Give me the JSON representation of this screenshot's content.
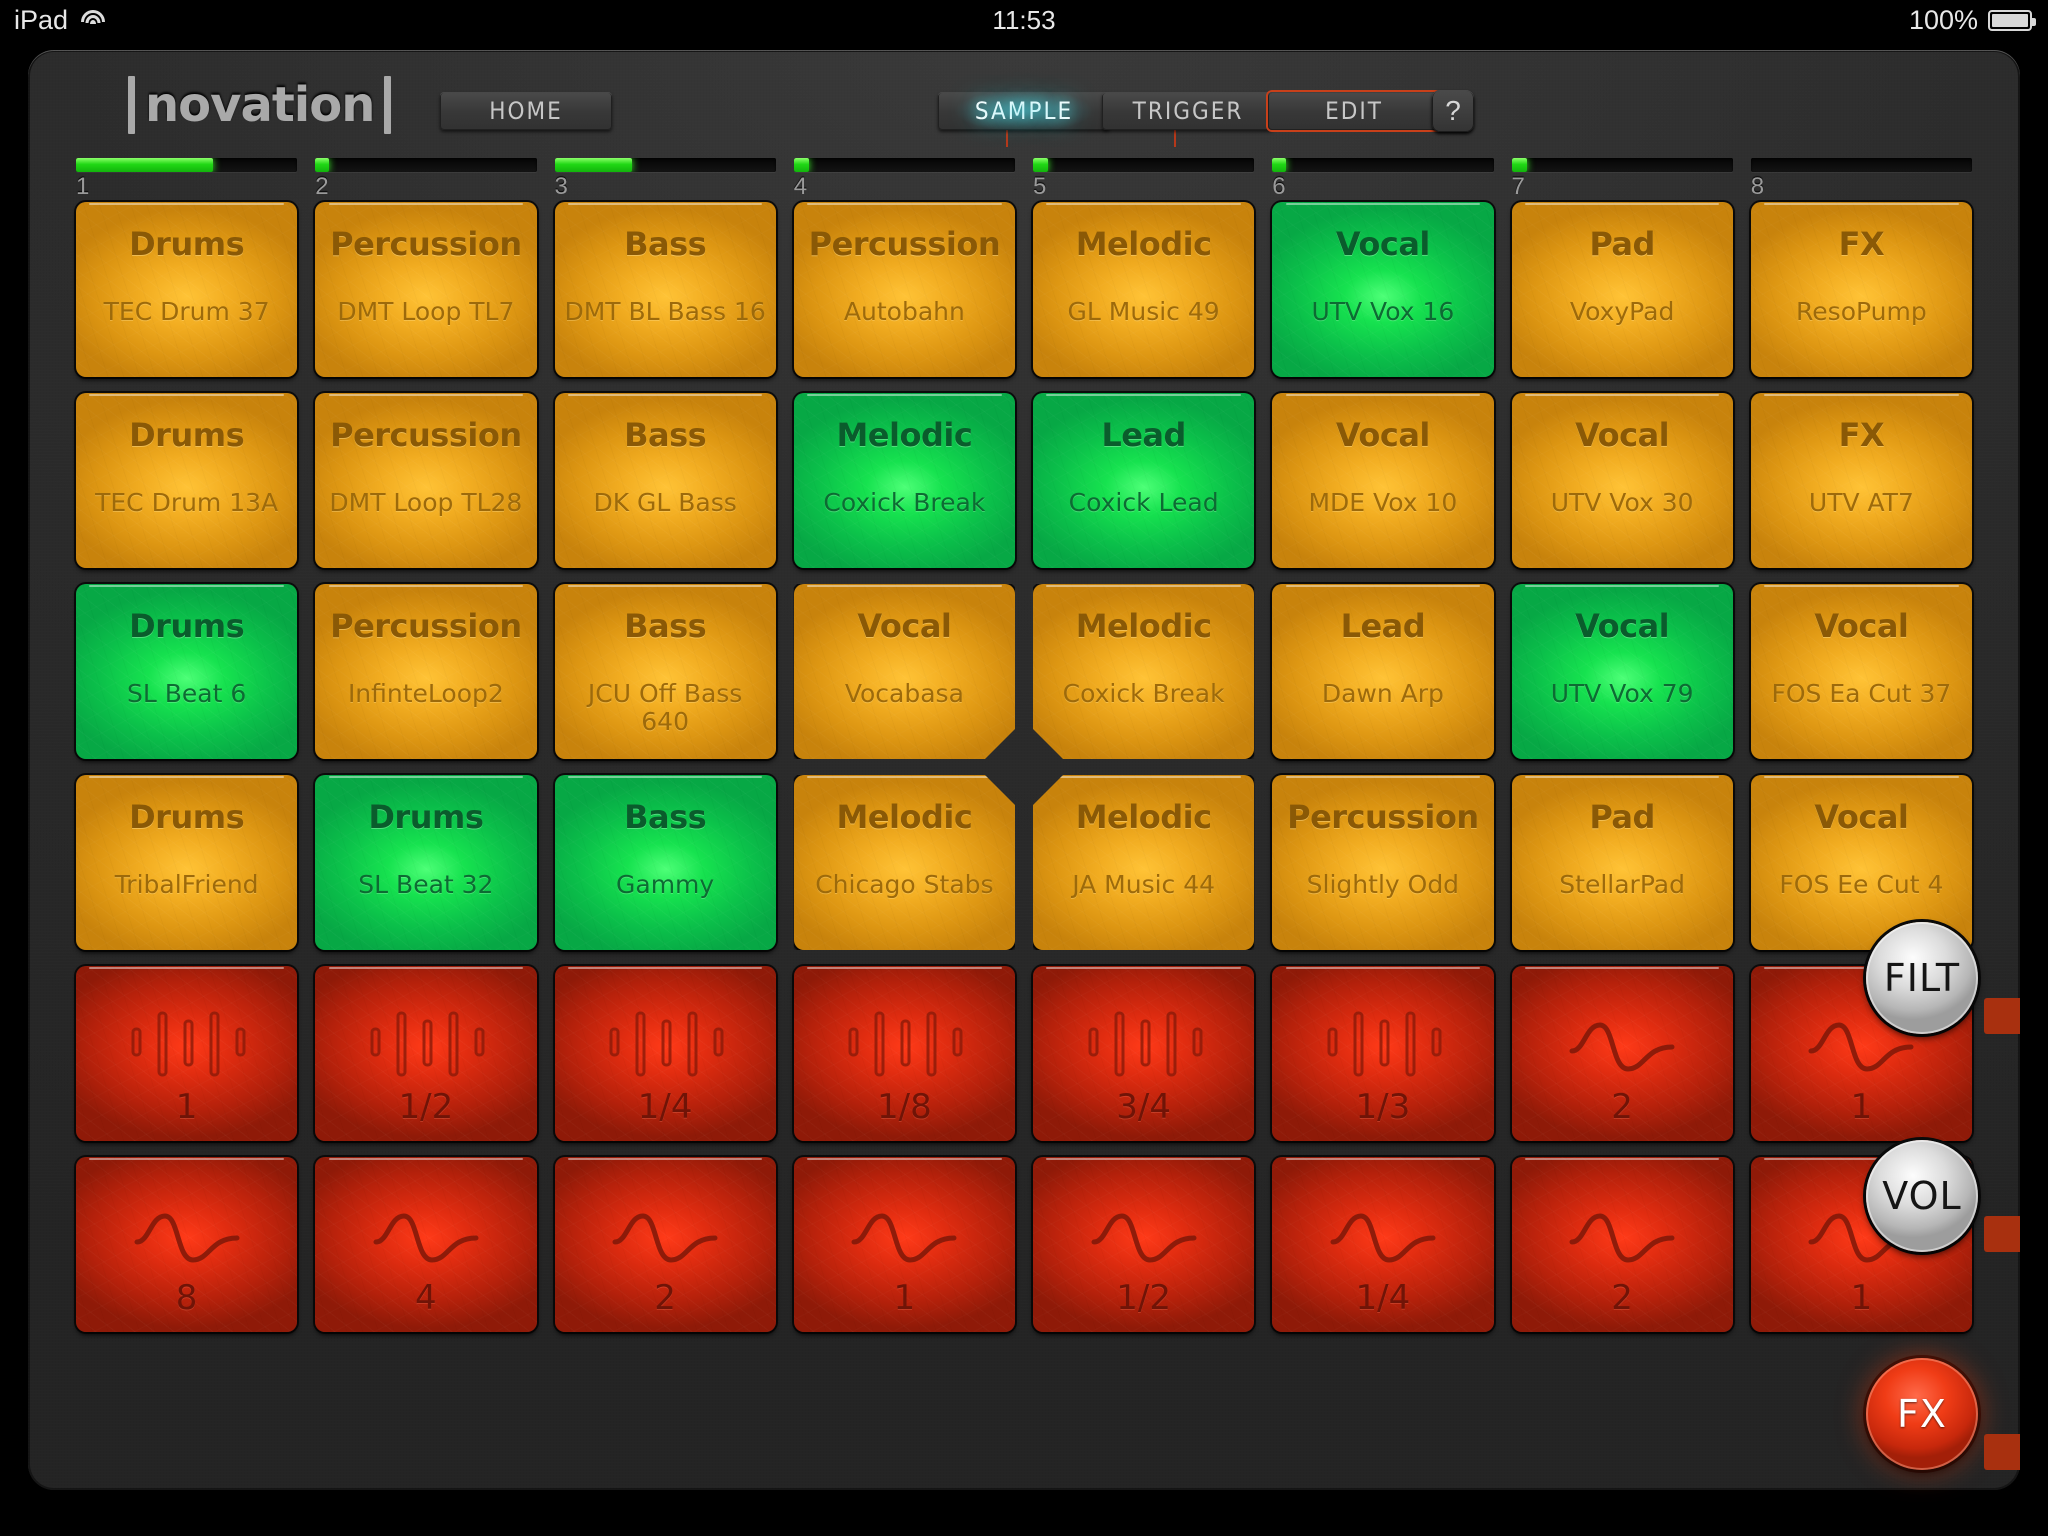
{
  "statusbar": {
    "device": "iPad",
    "wifi_icon": "wifi-icon",
    "time": "11:53",
    "battery_percent": "100%",
    "battery_icon": "battery-full-icon"
  },
  "header": {
    "brand": "novation",
    "home_label": "HOME",
    "sample_label": "SAMPLE",
    "trigger_label": "TRIGGER",
    "edit_label": "EDIT",
    "help_label": "?",
    "active_tab": "SAMPLE",
    "highlight_color": "#c9401a",
    "active_glow_color": "#3cdceb"
  },
  "tracks": [
    {
      "number": "1",
      "level": 62
    },
    {
      "number": "2",
      "level": 6
    },
    {
      "number": "3",
      "level": 35
    },
    {
      "number": "4",
      "level": 7
    },
    {
      "number": "5",
      "level": 7
    },
    {
      "number": "6",
      "level": 6
    },
    {
      "number": "7",
      "level": 7
    },
    {
      "number": "8",
      "level": 0
    }
  ],
  "pads": [
    {
      "category": "Drums",
      "name": "TEC Drum 37",
      "state": "amber",
      "notch": ""
    },
    {
      "category": "Percussion",
      "name": "DMT Loop TL7",
      "state": "amber",
      "notch": ""
    },
    {
      "category": "Bass",
      "name": "DMT BL Bass 16",
      "state": "amber",
      "notch": ""
    },
    {
      "category": "Percussion",
      "name": "Autobahn",
      "state": "amber",
      "notch": ""
    },
    {
      "category": "Melodic",
      "name": "GL Music 49",
      "state": "amber",
      "notch": ""
    },
    {
      "category": "Vocal",
      "name": "UTV Vox 16",
      "state": "green",
      "notch": ""
    },
    {
      "category": "Pad",
      "name": "VoxyPad",
      "state": "amber",
      "notch": ""
    },
    {
      "category": "FX",
      "name": "ResoPump",
      "state": "amber",
      "notch": ""
    },
    {
      "category": "Drums",
      "name": "TEC Drum 13A",
      "state": "amber",
      "notch": ""
    },
    {
      "category": "Percussion",
      "name": "DMT Loop TL28",
      "state": "amber",
      "notch": ""
    },
    {
      "category": "Bass",
      "name": "DK GL Bass",
      "state": "amber",
      "notch": ""
    },
    {
      "category": "Melodic",
      "name": "Coxick Break",
      "state": "green",
      "notch": ""
    },
    {
      "category": "Lead",
      "name": "Coxick Lead",
      "state": "green",
      "notch": ""
    },
    {
      "category": "Vocal",
      "name": "MDE Vox 10",
      "state": "amber",
      "notch": ""
    },
    {
      "category": "Vocal",
      "name": "UTV Vox 30",
      "state": "amber",
      "notch": ""
    },
    {
      "category": "FX",
      "name": "UTV AT7",
      "state": "amber",
      "notch": ""
    },
    {
      "category": "Drums",
      "name": "SL Beat 6",
      "state": "green",
      "notch": ""
    },
    {
      "category": "Percussion",
      "name": "InfinteLoop2",
      "state": "amber",
      "notch": ""
    },
    {
      "category": "Bass",
      "name": "JCU Off Bass 640",
      "state": "amber",
      "notch": ""
    },
    {
      "category": "Vocal",
      "name": "Vocabasa",
      "state": "amber",
      "notch": "notch-br"
    },
    {
      "category": "Melodic",
      "name": "Coxick Break",
      "state": "amber",
      "notch": "notch-bl"
    },
    {
      "category": "Lead",
      "name": "Dawn Arp",
      "state": "amber",
      "notch": ""
    },
    {
      "category": "Vocal",
      "name": "UTV Vox 79",
      "state": "green",
      "notch": ""
    },
    {
      "category": "Vocal",
      "name": "FOS Ea Cut 37",
      "state": "amber",
      "notch": ""
    },
    {
      "category": "Drums",
      "name": "TribalFriend",
      "state": "amber",
      "notch": ""
    },
    {
      "category": "Drums",
      "name": "SL Beat 32",
      "state": "green",
      "notch": ""
    },
    {
      "category": "Bass",
      "name": "Gammy",
      "state": "green",
      "notch": ""
    },
    {
      "category": "Melodic",
      "name": "Chicago Stabs",
      "state": "amber",
      "notch": "notch-tr"
    },
    {
      "category": "Melodic",
      "name": "JA Music 44",
      "state": "amber",
      "notch": "notch-tl"
    },
    {
      "category": "Percussion",
      "name": "Slightly Odd",
      "state": "amber",
      "notch": ""
    },
    {
      "category": "Pad",
      "name": "StellarPad",
      "state": "amber",
      "notch": ""
    },
    {
      "category": "Vocal",
      "name": "FOS Ee Cut 4",
      "state": "amber",
      "notch": ""
    },
    {
      "label": "1",
      "state": "red",
      "glyph": "bars-icon"
    },
    {
      "label": "1/2",
      "state": "red",
      "glyph": "bars-icon"
    },
    {
      "label": "1/4",
      "state": "red",
      "glyph": "bars-icon"
    },
    {
      "label": "1/8",
      "state": "red",
      "glyph": "bars-icon"
    },
    {
      "label": "3/4",
      "state": "red",
      "glyph": "bars-icon"
    },
    {
      "label": "1/3",
      "state": "red",
      "glyph": "bars-icon"
    },
    {
      "label": "2",
      "state": "red",
      "glyph": "sine-icon"
    },
    {
      "label": "1",
      "state": "red",
      "glyph": "sine-icon"
    },
    {
      "label": "8",
      "state": "red",
      "glyph": "sine-icon"
    },
    {
      "label": "4",
      "state": "red",
      "glyph": "sine-icon"
    },
    {
      "label": "2",
      "state": "red",
      "glyph": "sine-icon"
    },
    {
      "label": "1",
      "state": "red",
      "glyph": "sine-icon"
    },
    {
      "label": "1/2",
      "state": "red",
      "glyph": "sine-icon"
    },
    {
      "label": "1/4",
      "state": "red",
      "glyph": "sine-icon"
    },
    {
      "label": "2",
      "state": "red",
      "glyph": "sine-icon"
    },
    {
      "label": "1",
      "state": "red",
      "glyph": "sine-icon"
    }
  ],
  "knobs": {
    "filter_label": "FILT",
    "volume_label": "VOL",
    "fx_label": "FX"
  }
}
